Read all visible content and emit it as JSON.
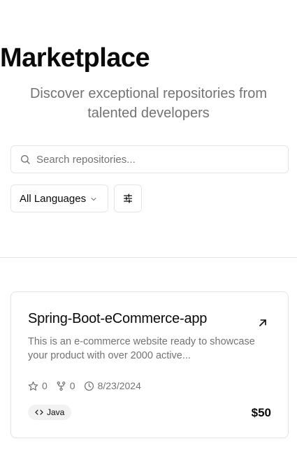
{
  "header": {
    "title": "Marketplace",
    "subtitle": "Discover exceptional repositories from talented developers"
  },
  "search": {
    "placeholder": "Search repositories...",
    "value": "",
    "icon": "search-icon"
  },
  "filters": {
    "language_selected": "All Languages",
    "language_icon": "chevron-down-icon",
    "filter_icon": "sliders-icon"
  },
  "repositories": [
    {
      "name": "Spring-Boot-eCommerce-app",
      "description": "This is an e-commerce website ready to showcase your product with over 2000 active...",
      "stars": "0",
      "forks": "0",
      "updated": "8/23/2024",
      "language": "Java",
      "price": "$50"
    }
  ],
  "colors": {
    "text_primary": "#0a0a0a",
    "text_muted": "#737373",
    "border": "#e5e5e5",
    "badge_bg": "#f2f2f2"
  }
}
